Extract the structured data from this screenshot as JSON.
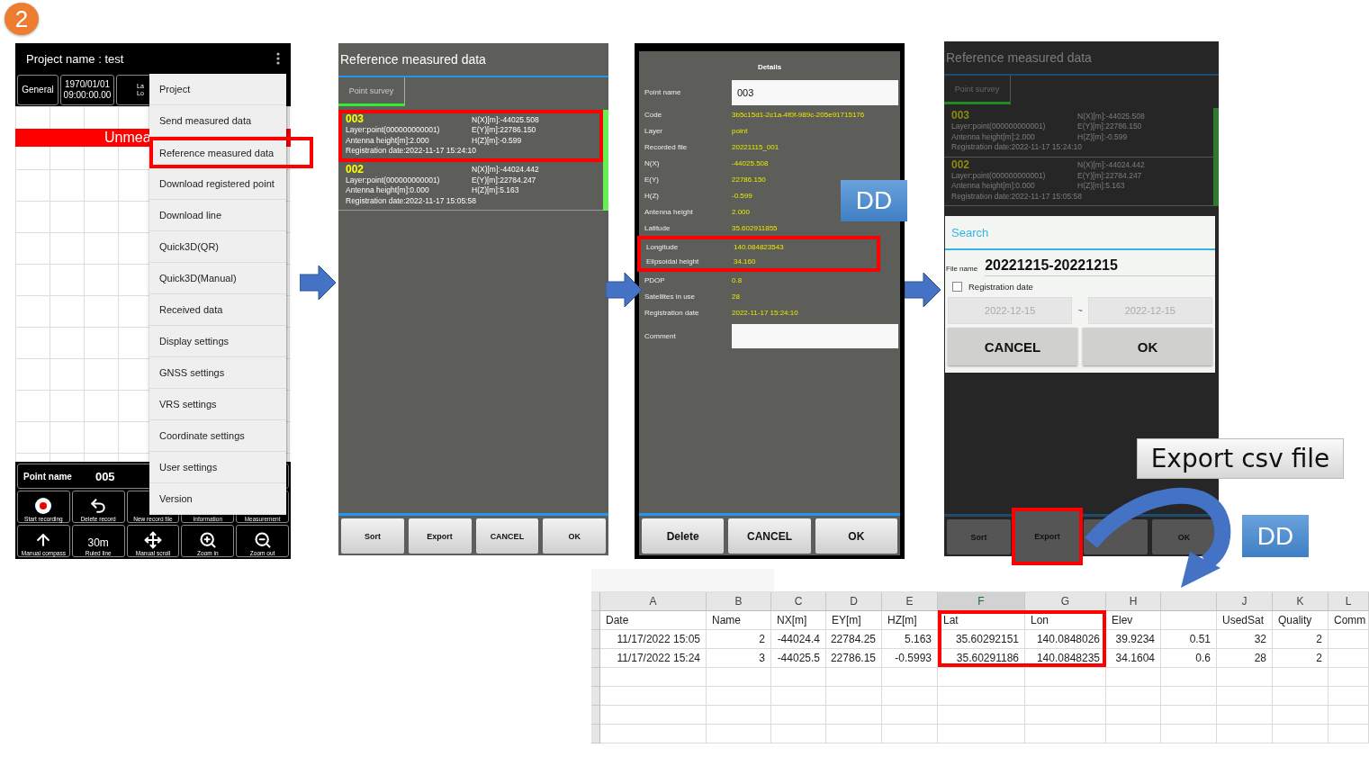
{
  "step_badge": "2",
  "main_screen": {
    "title": "Project name : test",
    "status_cells": [
      {
        "lines": [
          "General"
        ]
      },
      {
        "lines": [
          "1970/01/01",
          "09:00:00.00"
        ]
      },
      {
        "lines": [
          "La",
          "Lo"
        ]
      }
    ],
    "banner": "Unmea",
    "menu": [
      {
        "label": "Project",
        "highlighted": false
      },
      {
        "label": "Send measured data",
        "highlighted": false
      },
      {
        "label": "Reference measured data",
        "highlighted": true
      },
      {
        "label": "Download registered point",
        "highlighted": false
      },
      {
        "label": "Download line",
        "highlighted": false
      },
      {
        "label": "Quick3D(QR)",
        "highlighted": false
      },
      {
        "label": "Quick3D(Manual)",
        "highlighted": false
      },
      {
        "label": "Received data",
        "highlighted": false
      },
      {
        "label": "Display settings",
        "highlighted": false
      },
      {
        "label": "GNSS settings",
        "highlighted": false
      },
      {
        "label": "VRS settings",
        "highlighted": false
      },
      {
        "label": "Coordinate settings",
        "highlighted": false
      },
      {
        "label": "User settings",
        "highlighted": false
      },
      {
        "label": "Version",
        "highlighted": false
      }
    ],
    "point_label": "Point name",
    "point_value": "005",
    "buttons": [
      {
        "label": "Start recording",
        "kind": "record"
      },
      {
        "label": "Delete record",
        "kind": "undo"
      },
      {
        "label": "New record file",
        "kind": "none"
      },
      {
        "label": "Information",
        "kind": "none"
      },
      {
        "label": "Measurement",
        "kind": "none"
      },
      {
        "label": "Manual compass",
        "kind": "arrow-up"
      },
      {
        "label": "Ruled line",
        "kind": "text",
        "icon_text": "30m"
      },
      {
        "label": "Manual scroll",
        "kind": "move"
      },
      {
        "label": "Zoom in",
        "kind": "zoom-in"
      },
      {
        "label": "Zoom out",
        "kind": "zoom-out"
      }
    ]
  },
  "reference_screen": {
    "title": "Reference measured data",
    "tabs": [
      {
        "label": "Point survey",
        "selected": true
      }
    ],
    "records": [
      {
        "name": "003",
        "layer": "Layer:point(000000000001)",
        "antenna": "Antenna height[m]:2.000",
        "registration": "Registration date:2022-11-17 15:24:10",
        "n": "N(X)[m]:-44025.508",
        "e": "E(Y)[m]:22786.150",
        "h": "H(Z)[m]:-0.599",
        "highlighted": true
      },
      {
        "name": "002",
        "layer": "Layer:point(000000000001)",
        "antenna": "Antenna height[m]:0.000",
        "registration": "Registration date:2022-11-17 15:05:58",
        "n": "N(X)[m]:-44024.442",
        "e": "E(Y)[m]:22784.247",
        "h": "H(Z)[m]:5.163",
        "highlighted": false
      }
    ],
    "buttons": [
      {
        "label": "Sort"
      },
      {
        "label": "Export"
      },
      {
        "label": "CANCEL"
      },
      {
        "label": "OK"
      }
    ]
  },
  "details_screen": {
    "title": "Details",
    "point_name": {
      "label": "Point name",
      "value": "003"
    },
    "rows": [
      {
        "label": "Code",
        "value": "3b5c15d1-2c1a-4f0f-989c-205e91715176",
        "highlighted": false
      },
      {
        "label": "Layer",
        "value": "point",
        "highlighted": false
      },
      {
        "label": "Recorded file",
        "value": "20221115_001",
        "highlighted": false
      },
      {
        "label": "N(X)",
        "value": "-44025.508",
        "highlighted": false
      },
      {
        "label": "E(Y)",
        "value": "22786.150",
        "highlighted": false
      },
      {
        "label": "H(Z)",
        "value": "-0.599",
        "highlighted": false
      },
      {
        "label": "Antenna height",
        "value": "2.000",
        "highlighted": false
      },
      {
        "label": "Latitude",
        "value": "35.602911855",
        "highlighted": false
      },
      {
        "label": "Longitude",
        "value": "140.084823543",
        "highlighted": true
      },
      {
        "label": "Elipsoidal height",
        "value": "34.160",
        "highlighted": true
      },
      {
        "label": "PDOP",
        "value": "0.8",
        "highlighted": false
      },
      {
        "label": "Satellites in use",
        "value": "28",
        "highlighted": false
      },
      {
        "label": "Registration date",
        "value": "2022-11-17 15:24:10",
        "highlighted": false
      }
    ],
    "comment": {
      "label": "Comment"
    },
    "buttons": [
      {
        "label": "Delete"
      },
      {
        "label": "CANCEL"
      },
      {
        "label": "OK"
      }
    ]
  },
  "search_screen": {
    "title": "Reference measured data",
    "tabs": [
      {
        "label": "Point survey",
        "selected": true
      }
    ],
    "records": [
      {
        "name": "003",
        "layer": "Layer:point(000000000001)",
        "antenna": "Antenna height[m]:2.000",
        "registration": "Registration date:2022-11-17 15:24:10",
        "n": "N(X)[m]:-44025.508",
        "e": "E(Y)[m]:22786.150",
        "h": "H(Z)[m]:-0.599"
      },
      {
        "name": "002",
        "layer": "Layer:point(000000000001)",
        "antenna": "Antenna height[m]:0.000",
        "registration": "Registration date:2022-11-17 15:05:58",
        "n": "N(X)[m]:-44024.442",
        "e": "E(Y)[m]:22784.247",
        "h": "H(Z)[m]:5.163"
      }
    ],
    "dialog": {
      "title": "Search",
      "file_label": "File name",
      "file_value": "20221215-20221215",
      "checkbox": {
        "label": "Registration date",
        "checked": false
      },
      "date_from": "2022-12-15",
      "separator": "~",
      "date_to": "2022-12-15",
      "buttons": [
        "CANCEL",
        "OK"
      ]
    },
    "buttons": [
      {
        "label": "Sort",
        "highlighted": false
      },
      {
        "label": "Export",
        "highlighted": true
      },
      {
        "highlighted": false
      },
      {
        "label": "OK",
        "highlighted": false
      }
    ]
  },
  "callouts": [
    "DD",
    "DD",
    "Export csv file"
  ],
  "spreadsheet": {
    "columns": [
      {
        "letter": "A",
        "heading": "Date",
        "selected": false
      },
      {
        "letter": "B",
        "heading": "Name",
        "selected": false
      },
      {
        "letter": "C",
        "heading": "NX[m]",
        "selected": false
      },
      {
        "letter": "D",
        "heading": "EY[m]",
        "selected": false
      },
      {
        "letter": "E",
        "heading": "HZ[m]",
        "selected": false
      },
      {
        "letter": "F",
        "heading": "Lat",
        "selected": true
      },
      {
        "letter": "G",
        "heading": "Lon",
        "selected": false
      },
      {
        "letter": "H",
        "heading": "Elev",
        "selected": false
      },
      {
        "selected": false
      },
      {
        "letter": "J",
        "heading": "UsedSat",
        "selected": false
      },
      {
        "letter": "K",
        "heading": "Quality",
        "selected": false
      },
      {
        "letter": "L",
        "heading": "Comm",
        "selected": false
      }
    ],
    "rows": [
      [
        "11/17/2022 15:05",
        "2",
        "-44024.4",
        "22784.25",
        "5.163",
        "35.60292151",
        "140.0848026",
        "39.9234",
        "0.51",
        "32",
        "2"
      ],
      [
        "11/17/2022 15:24",
        "3",
        "-44025.5",
        "22786.15",
        "-0.5993",
        "35.60291186",
        "140.0848235",
        "34.1604",
        "0.6",
        "28",
        "2"
      ]
    ]
  }
}
